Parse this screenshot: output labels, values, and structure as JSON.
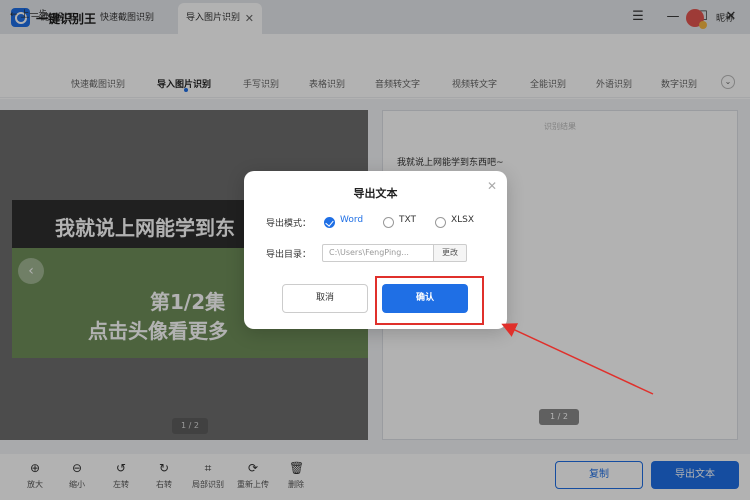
{
  "titlebar": {
    "tabs": [
      {
        "label": "一键识别王"
      },
      {
        "label": "快速截图识别"
      },
      {
        "label": "导入图片识别"
      }
    ],
    "close_glyph": "✕",
    "window_controls": [
      "☰",
      "—",
      "☐",
      "✕"
    ]
  },
  "header": {
    "brand": "一键识别王",
    "nickname": "昵称"
  },
  "navbar": {
    "back_label": "← 上一步",
    "items": [
      {
        "label": "快速截图识别"
      },
      {
        "label": "导入图片识别"
      },
      {
        "label": "手写识别"
      },
      {
        "label": "表格识别"
      },
      {
        "label": "音频转文字"
      },
      {
        "label": "视频转文字"
      },
      {
        "label": "全能识别"
      },
      {
        "label": "外语识别"
      },
      {
        "label": "数字识别"
      }
    ],
    "more_glyph": "⌄"
  },
  "left_panel": {
    "image_line1": "我就说上网能学到东",
    "image_line2": "第1/2集",
    "image_line3": "点击头像看更多",
    "prev_glyph": "‹",
    "pager": "1 / 2"
  },
  "right_panel": {
    "title": "识别结果",
    "text": "我就说上网能学到东西吧~",
    "pager": "1 / 2"
  },
  "toolbar": {
    "tools": [
      {
        "label": "放大",
        "icon": "⊕"
      },
      {
        "label": "缩小",
        "icon": "⊖"
      },
      {
        "label": "左转",
        "icon": "↺"
      },
      {
        "label": "右转",
        "icon": "↻"
      },
      {
        "label": "局部识别",
        "icon": "⌗"
      },
      {
        "label": "重新上传",
        "icon": "⟳"
      },
      {
        "label": "删除",
        "icon": "🗑"
      }
    ],
    "copy_label": "复制",
    "export_label": "导出文本"
  },
  "dialog": {
    "title": "导出文本",
    "close_glyph": "✕",
    "mode_label": "导出模式：",
    "modes": [
      {
        "label": "Word",
        "checked": true
      },
      {
        "label": "TXT",
        "checked": false
      },
      {
        "label": "XLSX",
        "checked": false
      }
    ],
    "dir_label": "导出目录：",
    "dir_value": "C:\\Users\\FengPing...",
    "change_label": "更改",
    "cancel_label": "取消",
    "confirm_label": "确认"
  },
  "colors": {
    "accent": "#1f6fe5",
    "annotation_red": "#e0302b"
  }
}
